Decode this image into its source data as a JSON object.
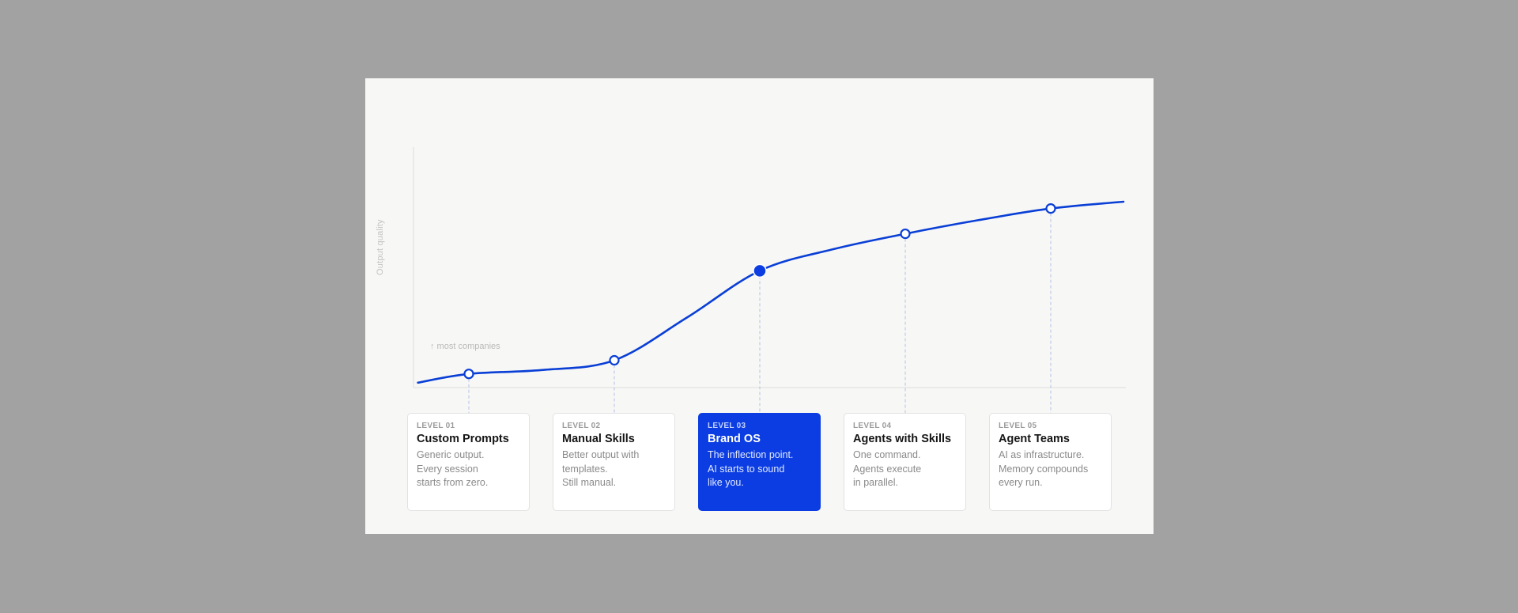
{
  "colors": {
    "background": "#a2a2a2",
    "slide": "#f7f7f5",
    "accent": "#0b3de2",
    "curve": "#0a3fd6",
    "axis": "#dcdcdc",
    "guide": "#b4c2e6"
  },
  "chart_data": {
    "type": "line",
    "title": "",
    "xlabel": "",
    "ylabel": "Output quality",
    "x_axis_ticks": false,
    "y_axis_ticks": false,
    "grid": false,
    "ylim": [
      0,
      100
    ],
    "categories": [
      "LEVEL 01",
      "LEVEL 02",
      "LEVEL 03",
      "LEVEL 04",
      "LEVEL 05"
    ],
    "series": [
      {
        "values": [
          5,
          12,
          58,
          77,
          90
        ],
        "highlight_index": 2
      }
    ],
    "curve_profile": [
      [
        -0.35,
        0.5
      ],
      [
        0,
        5
      ],
      [
        0.5,
        7
      ],
      [
        1,
        12
      ],
      [
        1.5,
        34
      ],
      [
        2,
        58
      ],
      [
        2.5,
        69
      ],
      [
        3,
        77
      ],
      [
        3.5,
        84
      ],
      [
        4,
        90
      ],
      [
        4.5,
        93.5
      ]
    ],
    "annotations": [
      {
        "text": "↑ most companies",
        "near_category": "LEVEL 01"
      }
    ]
  },
  "levels": [
    {
      "level": "LEVEL 01",
      "title": "Custom Prompts",
      "lines": [
        "Generic output.",
        "Every session",
        "starts from zero."
      ],
      "active": false
    },
    {
      "level": "LEVEL 02",
      "title": "Manual Skills",
      "lines": [
        "Better output with",
        "templates.",
        "Still manual."
      ],
      "active": false
    },
    {
      "level": "LEVEL 03",
      "title": "Brand OS",
      "lines": [
        "The inflection point.",
        "AI starts to sound",
        "like you."
      ],
      "active": true
    },
    {
      "level": "LEVEL 04",
      "title": "Agents with Skills",
      "lines": [
        "One command.",
        "Agents execute",
        "in parallel."
      ],
      "active": false
    },
    {
      "level": "LEVEL 05",
      "title": "Agent Teams",
      "lines": [
        "AI as infrastructure.",
        "Memory compounds",
        "every run."
      ],
      "active": false
    }
  ]
}
